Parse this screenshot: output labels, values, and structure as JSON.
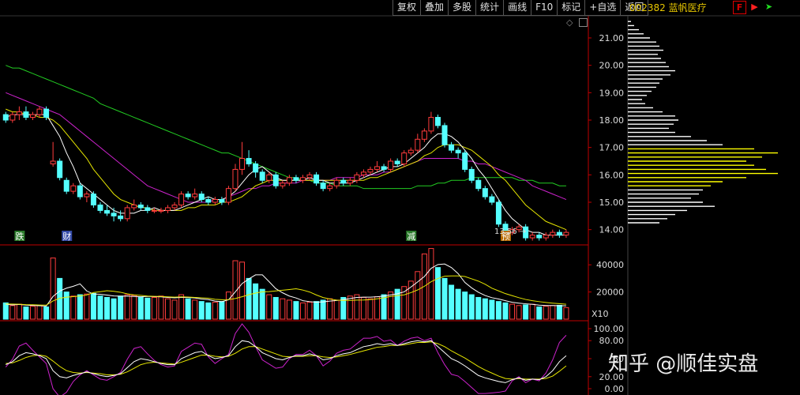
{
  "toolbar": {
    "buttons": [
      "复权",
      "叠加",
      "多股",
      "统计",
      "画线",
      "F10",
      "标记",
      "+自选",
      "返回"
    ]
  },
  "stock": {
    "code": "002382",
    "name": "蓝帆医疗",
    "title": "002382 蓝帆医疗"
  },
  "icons": [
    "diamond-icon",
    "square-icon",
    "f-box-icon",
    "red-arrow-icon",
    "green-arrow-icon",
    "scroll-up-icon"
  ],
  "watermark": "知乎 @顺佳实盘",
  "colors": {
    "up": "#ff3c3c",
    "down": "#55ffff",
    "ma5": "#ffffff",
    "ma10": "#e6e600",
    "ma20": "#cc22cc",
    "ma60": "#22cc22",
    "axis": "#c00000",
    "profile_white": "#ffffff",
    "profile_yellow": "#ffff00"
  },
  "price_axis": {
    "ticks": [
      "21.00",
      "20.00",
      "19.00",
      "18.00",
      "17.00",
      "16.00",
      "15.00",
      "14.00"
    ],
    "min": 13.5,
    "max": 21.75
  },
  "volume_axis": {
    "ticks": [
      "40000",
      "20000"
    ],
    "multiplier": "X10",
    "max": 50000
  },
  "kdj_axis": {
    "ticks": [
      "100.00",
      "80.00",
      "50",
      "20.00",
      "0.00"
    ]
  },
  "annotations": {
    "markers": [
      {
        "label": "跌",
        "bar": 2,
        "color": "#2a7a2a"
      },
      {
        "label": "财",
        "bar": 9,
        "color": "#334aa8"
      },
      {
        "label": "减",
        "bar": 60,
        "color": "#2a7a2a"
      },
      {
        "label": "预",
        "bar": 74,
        "color": "#b86a00"
      }
    ],
    "low_price": "13.56"
  },
  "chart_data": {
    "type": "candlestick",
    "candles": [
      [
        18.2,
        18.0,
        18.3,
        17.9
      ],
      [
        18.0,
        18.2,
        18.3,
        17.9
      ],
      [
        18.2,
        18.3,
        18.5,
        18.0
      ],
      [
        18.3,
        18.1,
        18.5,
        18.0
      ],
      [
        18.1,
        18.2,
        18.3,
        18.0
      ],
      [
        18.2,
        18.4,
        18.5,
        18.1
      ],
      [
        18.4,
        18.1,
        18.5,
        18.0
      ],
      [
        16.4,
        16.5,
        17.2,
        16.3
      ],
      [
        16.5,
        15.9,
        16.6,
        15.8
      ],
      [
        15.8,
        15.4,
        15.9,
        15.3
      ],
      [
        15.4,
        15.6,
        15.7,
        15.3
      ],
      [
        15.6,
        15.2,
        15.7,
        15.1
      ],
      [
        15.2,
        15.3,
        15.4,
        15.0
      ],
      [
        15.3,
        14.9,
        15.4,
        14.8
      ],
      [
        14.9,
        14.7,
        15.0,
        14.6
      ],
      [
        14.7,
        14.6,
        14.9,
        14.5
      ],
      [
        14.6,
        14.5,
        14.8,
        14.3
      ],
      [
        14.5,
        14.4,
        14.7,
        14.3
      ],
      [
        14.4,
        14.8,
        14.9,
        14.3
      ],
      [
        14.8,
        14.9,
        15.1,
        14.7
      ],
      [
        14.9,
        14.8,
        15.0,
        14.7
      ],
      [
        14.8,
        14.7,
        14.9,
        14.6
      ],
      [
        14.7,
        14.7,
        14.8,
        14.6
      ],
      [
        14.7,
        14.7,
        14.8,
        14.6
      ],
      [
        14.7,
        14.8,
        14.9,
        14.6
      ],
      [
        14.8,
        14.9,
        15.0,
        14.7
      ],
      [
        14.9,
        15.3,
        15.4,
        14.8
      ],
      [
        15.3,
        15.2,
        15.4,
        15.1
      ],
      [
        15.2,
        15.3,
        15.5,
        15.1
      ],
      [
        15.3,
        15.1,
        15.4,
        15.0
      ],
      [
        15.1,
        15.0,
        15.2,
        14.9
      ],
      [
        15.0,
        15.1,
        15.2,
        14.9
      ],
      [
        15.1,
        15.0,
        15.2,
        14.9
      ],
      [
        15.0,
        15.5,
        15.6,
        14.9
      ],
      [
        15.5,
        16.2,
        16.4,
        15.4
      ],
      [
        16.2,
        16.6,
        17.2,
        16.0
      ],
      [
        16.6,
        16.4,
        16.9,
        16.3
      ],
      [
        16.4,
        16.1,
        16.5,
        15.9
      ],
      [
        16.1,
        15.8,
        16.2,
        15.7
      ],
      [
        15.8,
        16.0,
        16.1,
        15.7
      ],
      [
        16.0,
        15.6,
        16.1,
        15.5
      ],
      [
        15.6,
        15.7,
        15.8,
        15.5
      ],
      [
        15.7,
        15.9,
        16.0,
        15.6
      ],
      [
        15.9,
        15.8,
        16.0,
        15.7
      ],
      [
        15.8,
        15.9,
        16.0,
        15.7
      ],
      [
        15.9,
        16.0,
        16.1,
        15.8
      ],
      [
        16.0,
        15.7,
        16.1,
        15.6
      ],
      [
        15.7,
        15.5,
        15.8,
        15.4
      ],
      [
        15.5,
        15.6,
        15.7,
        15.4
      ],
      [
        15.6,
        15.8,
        15.9,
        15.5
      ],
      [
        15.8,
        15.7,
        15.9,
        15.6
      ],
      [
        15.7,
        15.8,
        15.9,
        15.6
      ],
      [
        15.8,
        16.0,
        16.1,
        15.7
      ],
      [
        16.0,
        16.1,
        16.2,
        15.9
      ],
      [
        16.1,
        16.2,
        16.3,
        16.0
      ],
      [
        16.2,
        16.3,
        16.5,
        16.1
      ],
      [
        16.3,
        16.2,
        16.4,
        16.1
      ],
      [
        16.2,
        16.5,
        16.6,
        16.1
      ],
      [
        16.5,
        16.4,
        16.6,
        16.3
      ],
      [
        16.4,
        16.8,
        16.9,
        16.3
      ],
      [
        16.8,
        16.9,
        17.0,
        16.7
      ],
      [
        16.9,
        17.3,
        17.5,
        16.8
      ],
      [
        17.3,
        17.6,
        17.7,
        17.2
      ],
      [
        17.6,
        18.1,
        18.3,
        17.5
      ],
      [
        18.1,
        17.8,
        18.2,
        17.7
      ],
      [
        17.8,
        17.1,
        17.9,
        17.0
      ],
      [
        17.1,
        16.9,
        17.2,
        16.8
      ],
      [
        16.9,
        16.8,
        17.0,
        16.6
      ],
      [
        16.8,
        16.2,
        16.9,
        16.1
      ],
      [
        16.2,
        15.8,
        16.3,
        15.7
      ],
      [
        15.8,
        15.5,
        15.9,
        15.4
      ],
      [
        15.5,
        15.2,
        15.6,
        15.1
      ],
      [
        15.2,
        15.0,
        15.3,
        14.9
      ],
      [
        15.0,
        14.2,
        15.1,
        14.1
      ],
      [
        14.2,
        13.9,
        14.3,
        13.8
      ],
      [
        13.9,
        14.0,
        14.1,
        13.8
      ],
      [
        14.0,
        14.1,
        14.2,
        13.9
      ],
      [
        14.1,
        13.7,
        14.2,
        13.6
      ],
      [
        13.7,
        13.8,
        13.9,
        13.6
      ],
      [
        13.8,
        13.7,
        13.9,
        13.6
      ],
      [
        13.7,
        13.8,
        13.9,
        13.6
      ],
      [
        13.8,
        13.9,
        14.0,
        13.7
      ],
      [
        13.9,
        13.8,
        14.0,
        13.7
      ],
      [
        13.8,
        13.9,
        14.0,
        13.7
      ]
    ],
    "volumes": [
      12000,
      10000,
      11000,
      9000,
      9500,
      10000,
      9000,
      45000,
      30000,
      20000,
      17000,
      18000,
      18500,
      19000,
      17000,
      16000,
      15000,
      17000,
      18000,
      17500,
      16000,
      15500,
      16000,
      17000,
      15000,
      14000,
      18000,
      15000,
      14000,
      13000,
      12000,
      12500,
      13000,
      20000,
      43000,
      42000,
      30000,
      26000,
      22000,
      18000,
      16000,
      15000,
      14000,
      13000,
      12000,
      12500,
      13000,
      14000,
      15000,
      14000,
      16000,
      17000,
      18000,
      16000,
      15000,
      16500,
      18000,
      20000,
      22000,
      24000,
      28000,
      35000,
      48000,
      52000,
      38000,
      30000,
      25000,
      22000,
      20000,
      18000,
      16000,
      15000,
      14000,
      13000,
      12000,
      11000,
      10000,
      10500,
      11000,
      9000,
      9500,
      10000,
      10200,
      8500
    ],
    "ma5": [
      18.1,
      18.2,
      18.2,
      18.2,
      18.2,
      18.2,
      18.2,
      17.8,
      17.4,
      16.8,
      16.3,
      15.7,
      15.5,
      15.3,
      15.1,
      14.9,
      14.7,
      14.6,
      14.6,
      14.6,
      14.7,
      14.7,
      14.8,
      14.7,
      14.7,
      14.7,
      14.8,
      14.9,
      15.0,
      15.1,
      15.2,
      15.1,
      15.1,
      15.2,
      15.4,
      15.7,
      16.0,
      16.2,
      16.3,
      16.1,
      15.9,
      15.8,
      15.8,
      15.8,
      15.8,
      15.9,
      15.8,
      15.8,
      15.7,
      15.7,
      15.7,
      15.7,
      15.8,
      15.9,
      16.0,
      16.1,
      16.2,
      16.3,
      16.3,
      16.4,
      16.6,
      16.8,
      17.0,
      17.3,
      17.5,
      17.5,
      17.4,
      17.2,
      16.9,
      16.6,
      16.2,
      15.9,
      15.5,
      15.1,
      14.7,
      14.4,
      14.2,
      14.0,
      13.9,
      13.9,
      13.8,
      13.8,
      13.8,
      13.8
    ],
    "ma10": [
      18.4,
      18.3,
      18.3,
      18.2,
      18.2,
      18.1,
      18.1,
      18.0,
      17.8,
      17.5,
      17.2,
      16.9,
      16.6,
      16.2,
      15.9,
      15.6,
      15.3,
      15.1,
      15.0,
      14.9,
      14.8,
      14.8,
      14.7,
      14.7,
      14.7,
      14.7,
      14.7,
      14.8,
      14.8,
      14.9,
      14.9,
      14.9,
      15.0,
      15.0,
      15.1,
      15.2,
      15.4,
      15.6,
      15.7,
      15.8,
      15.8,
      15.8,
      15.8,
      15.8,
      15.8,
      15.8,
      15.8,
      15.8,
      15.8,
      15.8,
      15.8,
      15.8,
      15.8,
      15.8,
      15.9,
      15.9,
      16.0,
      16.1,
      16.2,
      16.3,
      16.4,
      16.5,
      16.7,
      16.8,
      17.0,
      17.1,
      17.1,
      17.1,
      17.0,
      16.9,
      16.7,
      16.5,
      16.3,
      16.0,
      15.8,
      15.5,
      15.2,
      14.9,
      14.7,
      14.5,
      14.3,
      14.2,
      14.1,
      14.0
    ],
    "ma20": [
      19.0,
      18.9,
      18.8,
      18.7,
      18.6,
      18.5,
      18.4,
      18.3,
      18.2,
      18.0,
      17.8,
      17.6,
      17.4,
      17.2,
      17.0,
      16.8,
      16.6,
      16.4,
      16.2,
      16.0,
      15.8,
      15.6,
      15.5,
      15.4,
      15.3,
      15.2,
      15.1,
      15.0,
      15.0,
      15.0,
      15.0,
      15.1,
      15.1,
      15.2,
      15.3,
      15.4,
      15.5,
      15.5,
      15.6,
      15.6,
      15.7,
      15.7,
      15.7,
      15.7,
      15.8,
      15.8,
      15.8,
      15.8,
      15.8,
      15.9,
      15.9,
      15.9,
      15.9,
      16.0,
      16.0,
      16.0,
      16.1,
      16.1,
      16.2,
      16.3,
      16.4,
      16.5,
      16.6,
      16.6,
      16.6,
      16.6,
      16.6,
      16.6,
      16.5,
      16.5,
      16.4,
      16.4,
      16.3,
      16.2,
      16.1,
      16.0,
      15.9,
      15.8,
      15.6,
      15.5,
      15.4,
      15.3,
      15.2,
      15.1
    ],
    "ma60": [
      20.0,
      19.9,
      19.9,
      19.8,
      19.7,
      19.6,
      19.5,
      19.4,
      19.3,
      19.2,
      19.1,
      19.0,
      18.9,
      18.8,
      18.6,
      18.5,
      18.4,
      18.3,
      18.2,
      18.1,
      18.0,
      17.9,
      17.8,
      17.7,
      17.6,
      17.5,
      17.4,
      17.3,
      17.2,
      17.1,
      17.0,
      16.9,
      16.8,
      16.8,
      16.7,
      16.6,
      16.5,
      16.4,
      16.3,
      16.2,
      16.1,
      16.0,
      15.9,
      15.9,
      15.8,
      15.8,
      15.7,
      15.7,
      15.7,
      15.6,
      15.6,
      15.6,
      15.6,
      15.5,
      15.5,
      15.5,
      15.5,
      15.5,
      15.5,
      15.5,
      15.5,
      15.6,
      15.6,
      15.6,
      15.7,
      15.7,
      15.8,
      15.8,
      15.8,
      15.9,
      15.9,
      15.9,
      15.9,
      15.9,
      15.9,
      15.9,
      15.8,
      15.8,
      15.8,
      15.7,
      15.7,
      15.7,
      15.6,
      15.6
    ],
    "vol_ma5": [
      11000,
      10500,
      10800,
      10300,
      10100,
      9900,
      9700,
      16700,
      20700,
      22800,
      24200,
      26000,
      20700,
      18500,
      18300,
      17700,
      17100,
      16900,
      17000,
      16700,
      16500,
      16800,
      16600,
      16400,
      16000,
      15700,
      16000,
      16000,
      15600,
      14800,
      14400,
      13300,
      12900,
      14300,
      20100,
      26200,
      29600,
      32600,
      32600,
      27600,
      22400,
      19400,
      17000,
      15600,
      13600,
      12900,
      12500,
      12700,
      13300,
      13700,
      14300,
      15200,
      16000,
      16200,
      16200,
      16500,
      17000,
      17900,
      18700,
      20100,
      23600,
      27400,
      31400,
      37400,
      40200,
      40600,
      38000,
      33500,
      27000,
      23000,
      19800,
      17400,
      15800,
      14800,
      13600,
      12400,
      11800,
      11300,
      10900,
      10300,
      10000,
      10000,
      9900,
      9800
    ],
    "vol_ma10": [
      11200,
      11100,
      11000,
      10700,
      10600,
      10400,
      10300,
      13400,
      15400,
      16200,
      16600,
      17100,
      17800,
      19600,
      20200,
      20900,
      20500,
      19800,
      18600,
      17900,
      17500,
      17000,
      16800,
      16700,
      16400,
      16200,
      16400,
      16300,
      16000,
      15700,
      15400,
      14600,
      14300,
      14400,
      15200,
      16500,
      18000,
      19200,
      20100,
      20300,
      20800,
      21300,
      21800,
      22400,
      21400,
      20000,
      17800,
      15900,
      14800,
      14000,
      13800,
      13800,
      14000,
      14100,
      14400,
      15000,
      15700,
      16700,
      17400,
      17900,
      19500,
      21500,
      24200,
      27600,
      29900,
      31600,
      31800,
      31800,
      31400,
      29700,
      28000,
      25700,
      22800,
      20800,
      18800,
      17300,
      15800,
      14500,
      13600,
      12900,
      12300,
      11800,
      11400,
      11000
    ],
    "kdj_k": [
      40,
      45,
      55,
      60,
      58,
      55,
      50,
      30,
      20,
      18,
      22,
      25,
      28,
      25,
      22,
      20,
      22,
      25,
      35,
      45,
      50,
      48,
      45,
      42,
      40,
      40,
      50,
      55,
      60,
      62,
      55,
      50,
      52,
      55,
      70,
      80,
      78,
      70,
      60,
      55,
      50,
      48,
      52,
      55,
      55,
      58,
      55,
      48,
      50,
      55,
      58,
      60,
      65,
      70,
      72,
      75,
      73,
      75,
      72,
      75,
      78,
      80,
      78,
      80,
      70,
      60,
      50,
      45,
      38,
      30,
      22,
      18,
      15,
      12,
      10,
      15,
      18,
      14,
      16,
      15,
      20,
      30,
      45,
      55
    ],
    "kdj_d": [
      42,
      43,
      47,
      52,
      55,
      56,
      54,
      46,
      37,
      30,
      27,
      26,
      27,
      26,
      25,
      23,
      23,
      24,
      28,
      34,
      40,
      43,
      44,
      43,
      42,
      41,
      44,
      48,
      52,
      56,
      56,
      54,
      53,
      54,
      59,
      66,
      70,
      70,
      66,
      62,
      58,
      54,
      53,
      54,
      54,
      55,
      55,
      53,
      52,
      53,
      55,
      57,
      60,
      63,
      66,
      69,
      70,
      72,
      72,
      73,
      75,
      77,
      77,
      78,
      75,
      70,
      63,
      57,
      51,
      44,
      37,
      31,
      26,
      21,
      17,
      16,
      17,
      16,
      16,
      16,
      17,
      21,
      29,
      38
    ],
    "kdj_j": [
      36,
      49,
      71,
      76,
      64,
      53,
      42,
      0,
      -14,
      -6,
      12,
      23,
      30,
      23,
      16,
      14,
      20,
      27,
      49,
      67,
      70,
      58,
      47,
      40,
      36,
      38,
      62,
      69,
      76,
      74,
      53,
      42,
      50,
      57,
      92,
      108,
      94,
      70,
      48,
      41,
      34,
      36,
      50,
      57,
      57,
      64,
      55,
      38,
      46,
      59,
      64,
      66,
      75,
      84,
      84,
      87,
      79,
      81,
      72,
      79,
      84,
      86,
      80,
      84,
      60,
      40,
      24,
      21,
      12,
      2,
      -8,
      -8,
      -7,
      -6,
      -4,
      13,
      20,
      10,
      16,
      13,
      26,
      48,
      77,
      89
    ],
    "volume_profile": {
      "prices": [
        21.6,
        21.45,
        21.3,
        21.15,
        21.0,
        20.85,
        20.7,
        20.55,
        20.4,
        20.25,
        20.1,
        19.95,
        19.8,
        19.65,
        19.5,
        19.35,
        19.2,
        19.05,
        18.9,
        18.75,
        18.6,
        18.45,
        18.3,
        18.15,
        18.0,
        17.85,
        17.7,
        17.55,
        17.4,
        17.25,
        17.1,
        16.95,
        16.8,
        16.65,
        16.5,
        16.35,
        16.2,
        16.05,
        15.9,
        15.75,
        15.6,
        15.45,
        15.3,
        15.15,
        15.0,
        14.85,
        14.7,
        14.55,
        14.4,
        14.25
      ],
      "amounts": [
        4,
        8,
        14,
        20,
        28,
        36,
        40,
        45,
        38,
        42,
        48,
        52,
        60,
        54,
        44,
        40,
        36,
        30,
        24,
        18,
        22,
        32,
        44,
        60,
        64,
        58,
        52,
        60,
        80,
        100,
        120,
        160,
        190,
        170,
        150,
        160,
        175,
        190,
        150,
        120,
        105,
        95,
        90,
        80,
        95,
        110,
        75,
        60,
        50,
        40
      ]
    }
  }
}
